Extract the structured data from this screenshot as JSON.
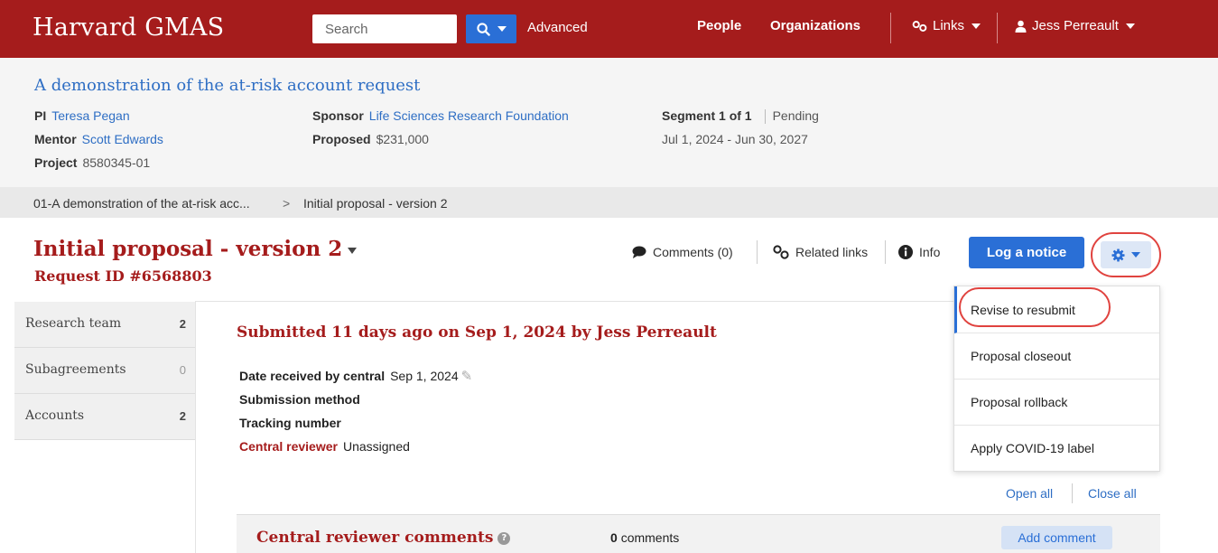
{
  "nav": {
    "brand": "Harvard GMAS",
    "search_placeholder": "Search",
    "advanced": "Advanced",
    "people": "People",
    "organizations": "Organizations",
    "links": "Links",
    "user": "Jess Perreault"
  },
  "summary": {
    "title": "A demonstration of the at-risk account request",
    "pi_label": "PI",
    "pi": "Teresa Pegan",
    "mentor_label": "Mentor",
    "mentor": "Scott Edwards",
    "project_label": "Project",
    "project": "8580345-01",
    "sponsor_label": "Sponsor",
    "sponsor": "Life Sciences Research Foundation",
    "proposed_label": "Proposed",
    "proposed": "$231,000",
    "segment": "Segment 1 of 1",
    "status": "Pending",
    "dates": "Jul 1, 2024 - Jun 30, 2027"
  },
  "breadcrumb": {
    "parent": "01-A demonstration of the at-risk acc...",
    "separator": ">",
    "current": "Initial proposal - version 2"
  },
  "page": {
    "title": "Initial proposal - version 2",
    "request_id": "Request ID #6568803",
    "comments": "Comments (0)",
    "related_links": "Related links",
    "info": "Info",
    "log_notice": "Log a notice"
  },
  "sidebar": {
    "items": [
      {
        "label": "Research team",
        "count": "2"
      },
      {
        "label": "Subagreements",
        "count": "0"
      },
      {
        "label": "Accounts",
        "count": "2"
      }
    ]
  },
  "main": {
    "submitted": "Submitted 11 days ago on Sep 1, 2024 by Jess Perreault",
    "date_received_label": "Date received by central",
    "date_received": "Sep 1, 2024",
    "submission_method_label": "Submission method",
    "tracking_number_label": "Tracking number",
    "central_reviewer_label": "Central reviewer",
    "central_reviewer": "Unassigned",
    "open_all": "Open all",
    "close_all": "Close all"
  },
  "menu": {
    "items": [
      "Revise to resubmit",
      "Proposal closeout",
      "Proposal rollback",
      "Apply COVID-19 label"
    ]
  },
  "comments_section": {
    "title": "Central reviewer comments",
    "count": "0",
    "count_label": "comments",
    "add": "Add comment"
  },
  "colors": {
    "brand": "#a51c1c",
    "accent": "#2a6fd6",
    "highlight_ring": "#e0433f"
  }
}
